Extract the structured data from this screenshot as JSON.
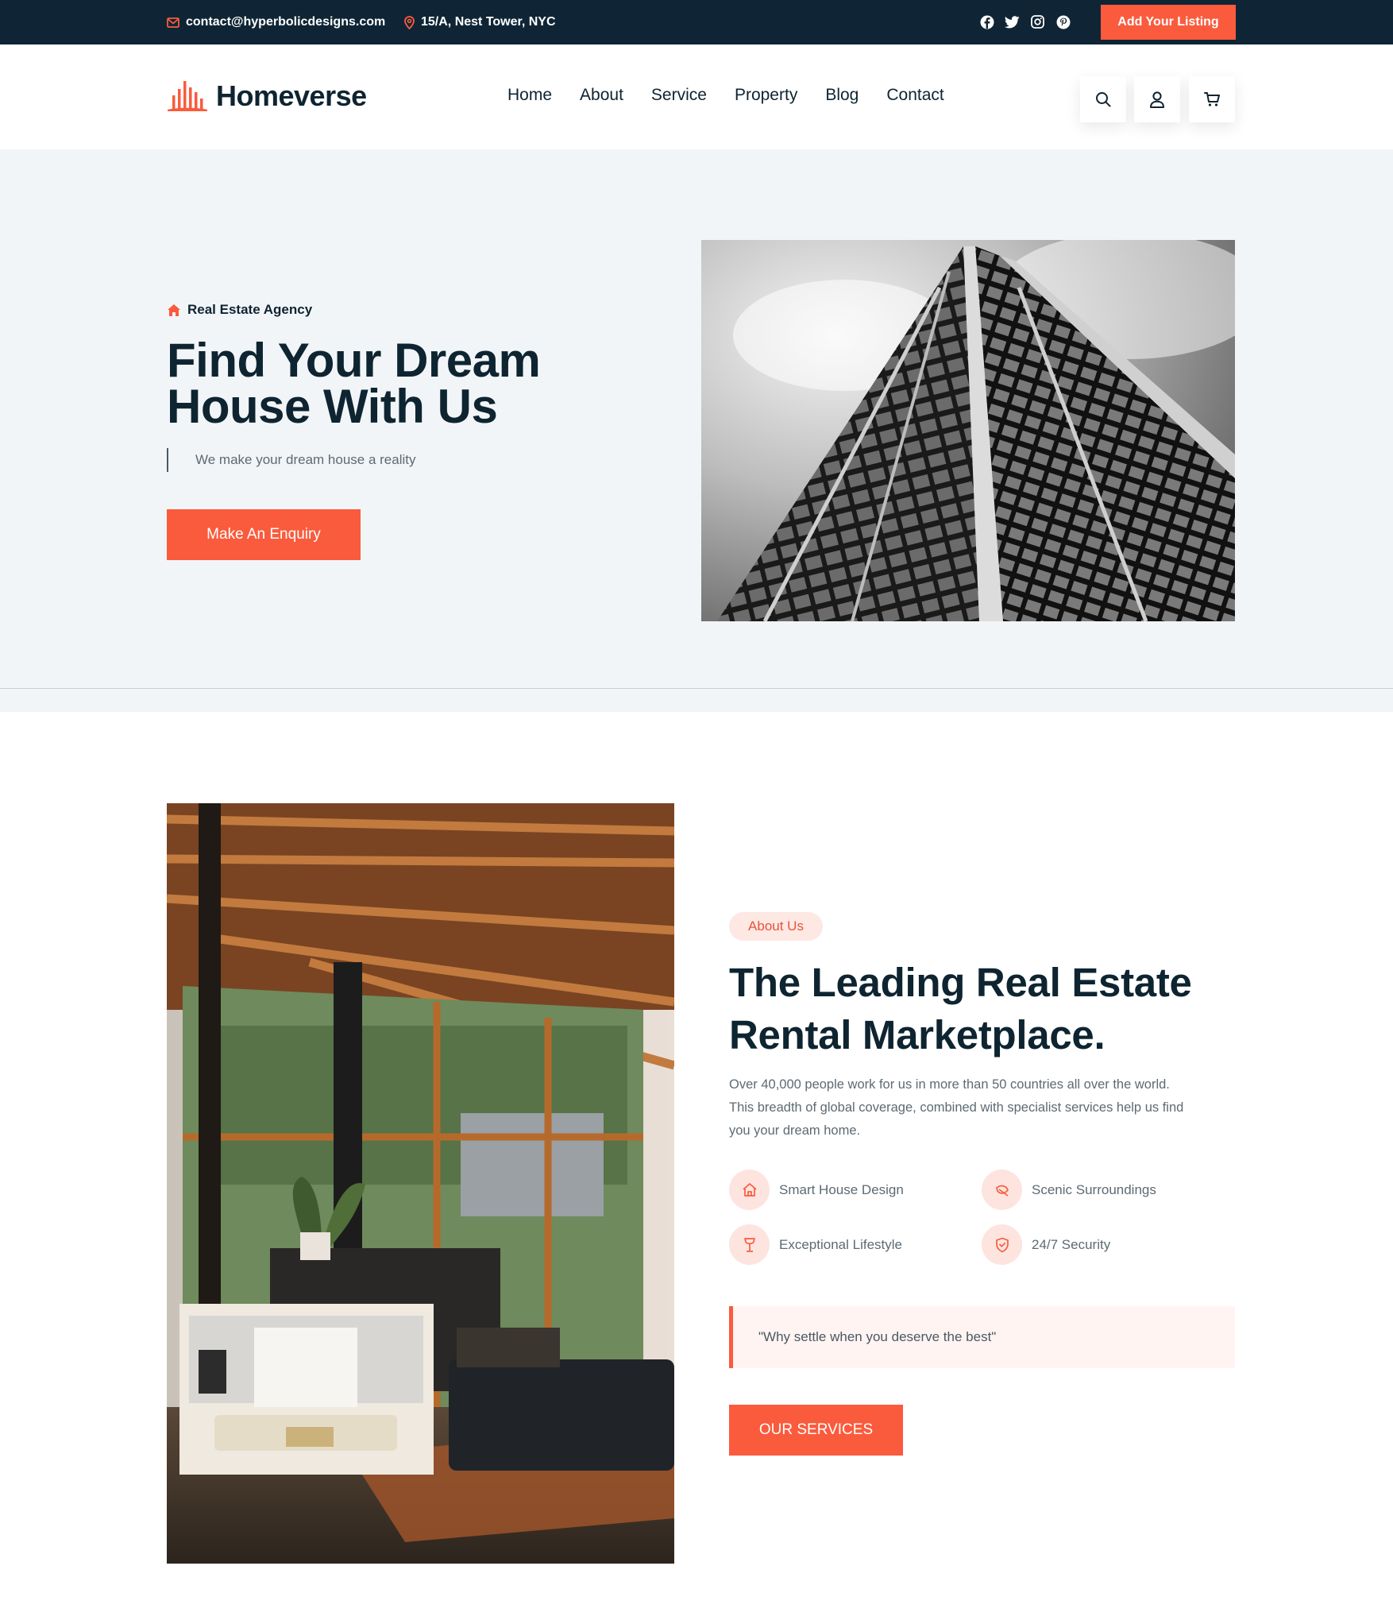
{
  "topbar": {
    "email": "contact@hyperbolicdesigns.com",
    "address": "15/A, Nest Tower, NYC",
    "social_icons": [
      "facebook-icon",
      "twitter-icon",
      "instagram-icon",
      "pinterest-icon"
    ],
    "listing_button": "Add Your Listing"
  },
  "header": {
    "logo_text": "Homeverse",
    "nav": [
      "Home",
      "About",
      "Service",
      "Property",
      "Blog",
      "Contact"
    ],
    "action_icons": [
      "search-icon",
      "user-icon",
      "cart-icon"
    ]
  },
  "hero": {
    "tag": "Real Estate Agency",
    "title_line1": "Find Your Dream",
    "title_line2": "House With Us",
    "subtitle": "We make your dream house a reality",
    "button": "Make An Enquiry"
  },
  "about": {
    "badge": "About Us",
    "title_line1": "The Leading Real Estate",
    "title_line2": "Rental Marketplace.",
    "text": "Over 40,000 people work for us in more than 50 countries all over the world. This breadth of global coverage, combined with specialist services help us find you your dream home.",
    "features": [
      {
        "label": "Smart House Design",
        "icon": "home-icon"
      },
      {
        "label": "Scenic Surroundings",
        "icon": "leaf-icon"
      },
      {
        "label": "Exceptional Lifestyle",
        "icon": "wine-glass-icon"
      },
      {
        "label": "24/7 Security",
        "icon": "shield-icon"
      }
    ],
    "quote": "\"Why settle when you deserve the best\"",
    "button": "OUR SERVICES"
  },
  "colors": {
    "accent": "#fa5b3d",
    "dark": "#0f2535",
    "hero_bg": "#f2f5f8",
    "badge_bg": "#fde8e4"
  }
}
